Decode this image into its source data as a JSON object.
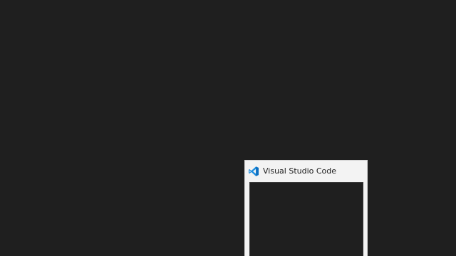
{
  "taskbar_preview": {
    "app_title": "Visual Studio Code",
    "icon": "vscode-icon",
    "accent": "#1e8ee0"
  }
}
